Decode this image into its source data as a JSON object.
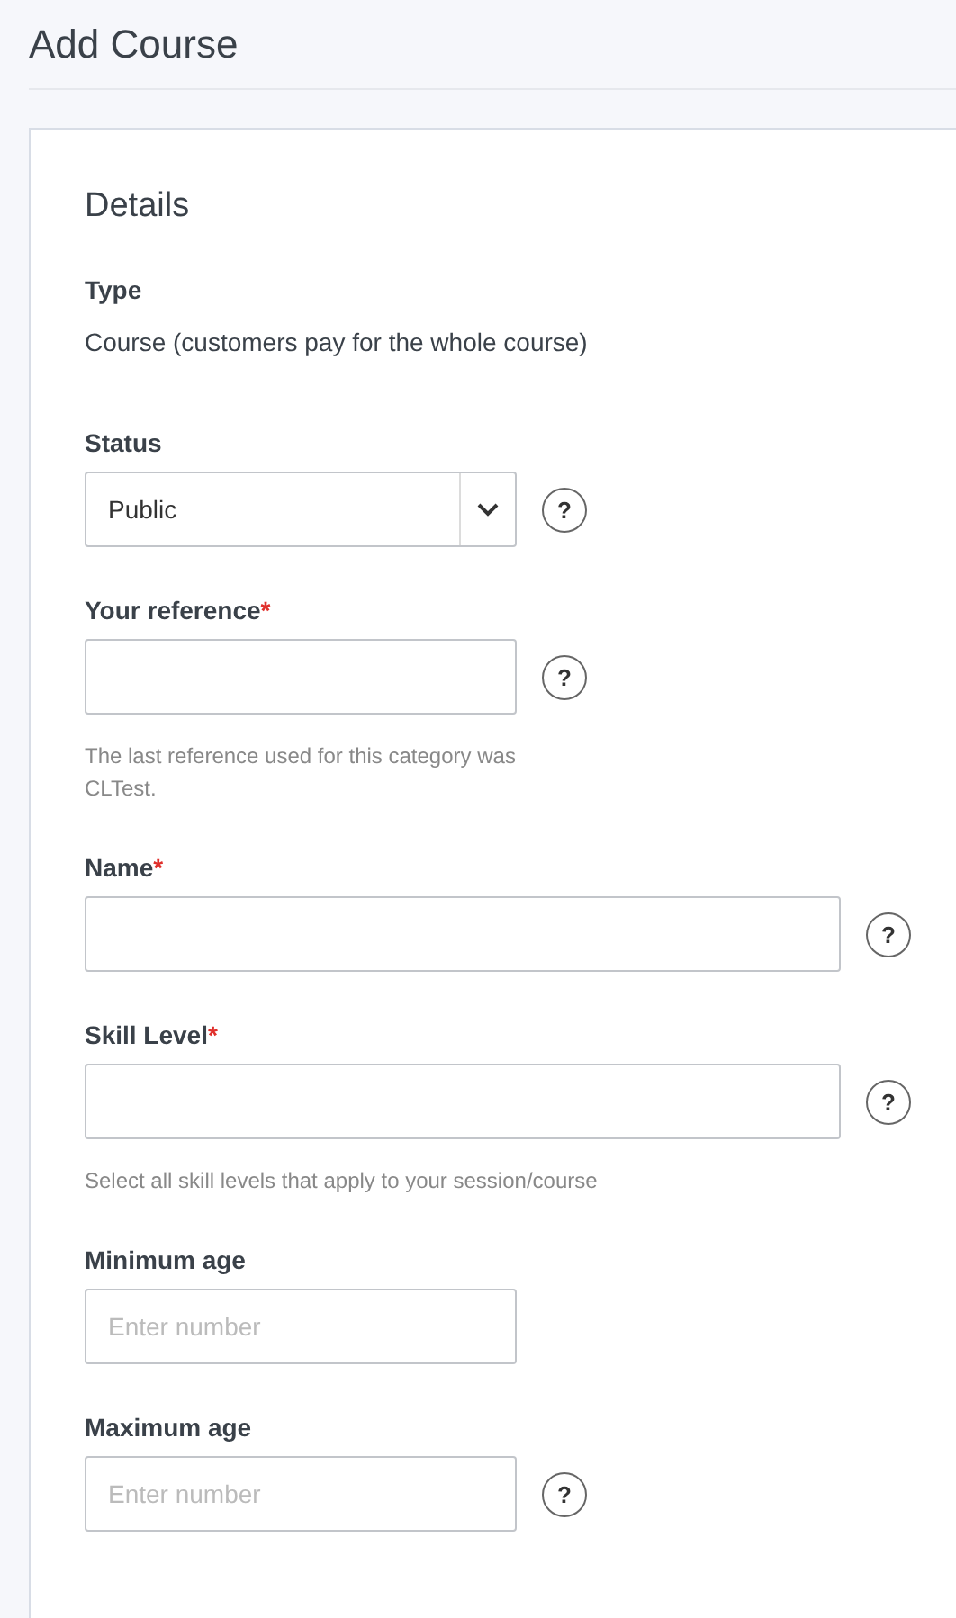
{
  "page": {
    "title": "Add Course"
  },
  "section": {
    "title": "Details"
  },
  "type": {
    "label": "Type",
    "value": "Course (customers pay for the whole course)"
  },
  "fields": [
    {
      "kind": "select",
      "label": "Status",
      "value": "Public",
      "wide": false,
      "help": "?"
    },
    {
      "kind": "text",
      "label": "Your reference",
      "required_mark": "*",
      "wide": false,
      "help": "?",
      "hint": "The last reference used for this category was CLTest."
    },
    {
      "kind": "text",
      "label": "Name",
      "required_mark": "*",
      "wide": true,
      "help": "?"
    },
    {
      "kind": "text",
      "label": "Skill Level",
      "required_mark": "*",
      "wide": true,
      "help": "?",
      "hint": "Select all skill levels that apply to your session/course"
    },
    {
      "kind": "text",
      "label": "Minimum age",
      "wide": false,
      "placeholder": "Enter number"
    },
    {
      "kind": "text",
      "label": "Maximum age",
      "wide": false,
      "help": "?",
      "placeholder": "Enter number"
    }
  ]
}
